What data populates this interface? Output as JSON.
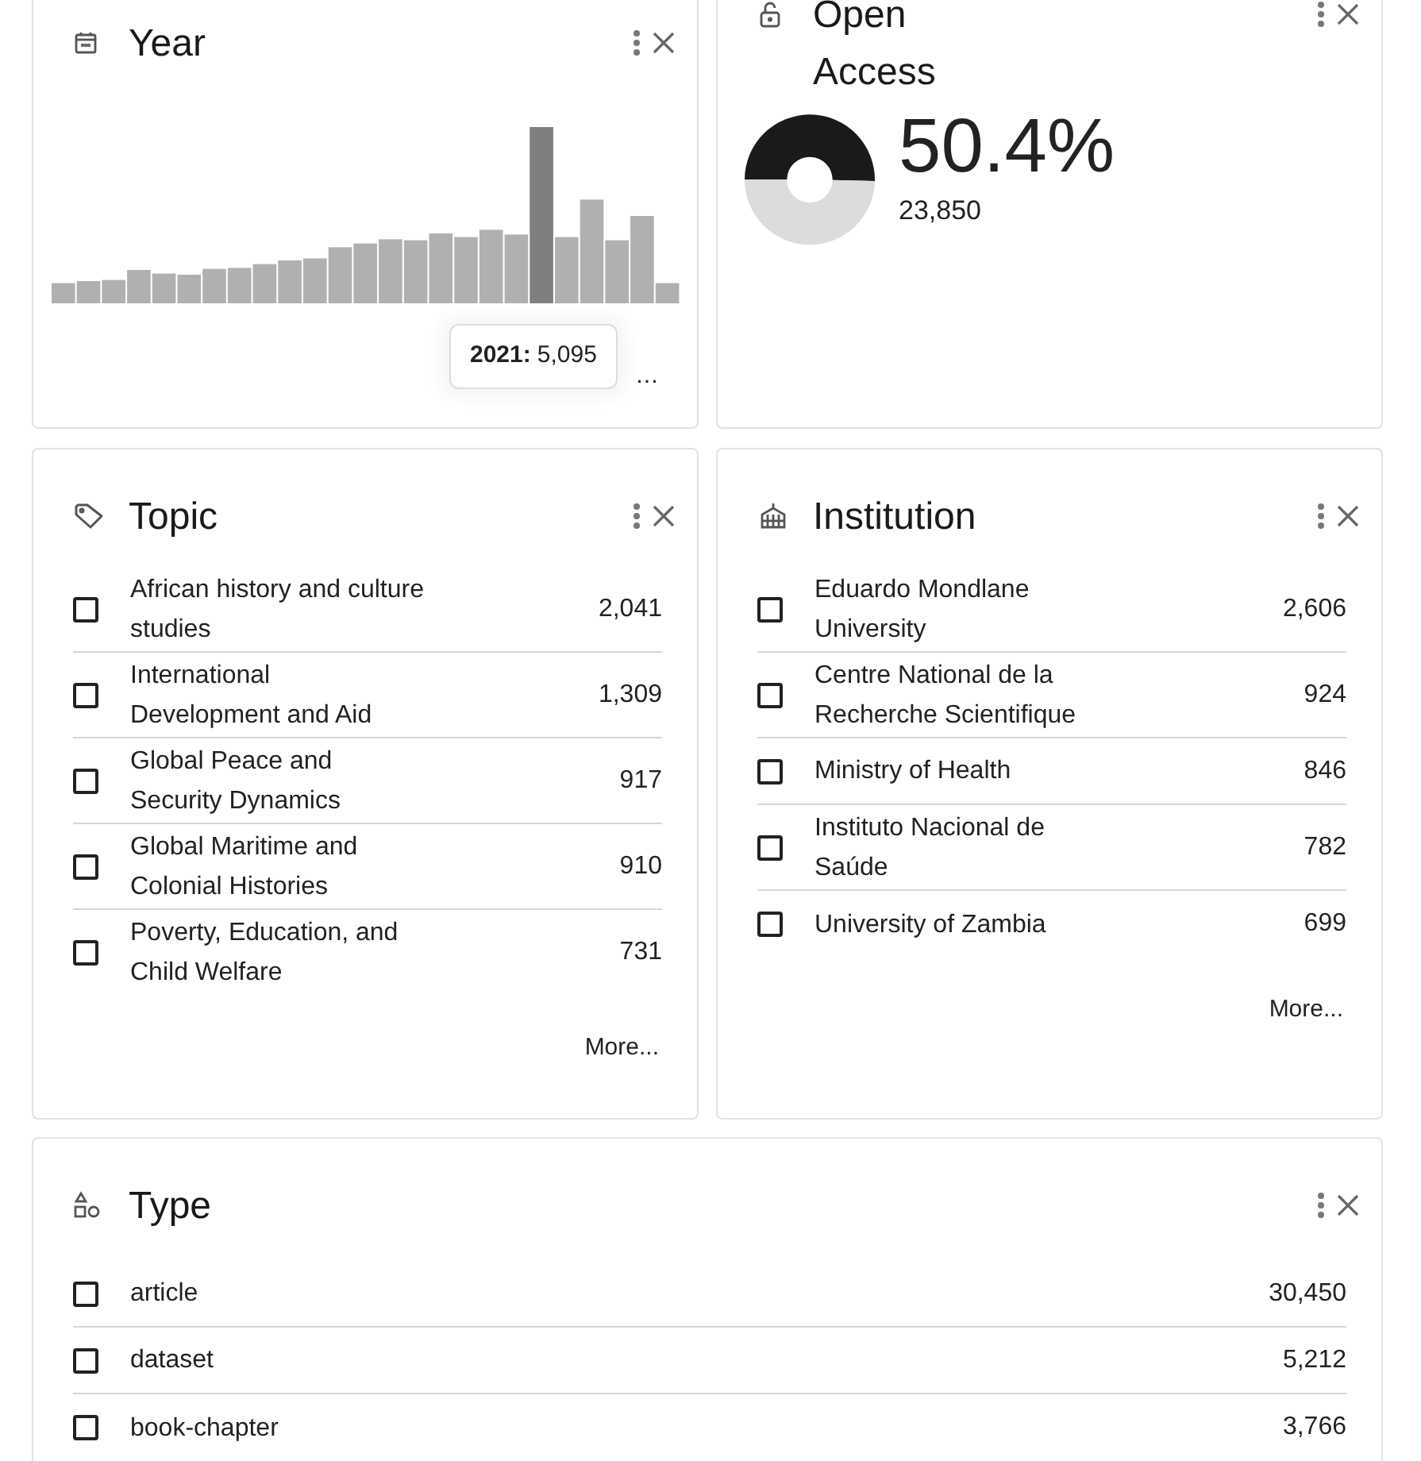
{
  "year": {
    "title": "Year",
    "tooltip": {
      "label": "2021:",
      "value": "5,095"
    },
    "overflow_label": "…"
  },
  "open_access": {
    "title": "Open Access",
    "percent": "50.4%",
    "count": "23,850",
    "chart_data": {
      "type": "donut",
      "values": [
        50.4,
        49.6
      ]
    }
  },
  "topic": {
    "title": "Topic",
    "more": "More...",
    "items": [
      {
        "label": "African history and culture studies",
        "count": "2,041",
        "checked": false
      },
      {
        "label": "International Development and Aid",
        "count": "1,309",
        "checked": false
      },
      {
        "label": "Global Peace and Security Dynamics",
        "count": "917",
        "checked": false
      },
      {
        "label": "Global Maritime and Colonial Histories",
        "count": "910",
        "checked": false
      },
      {
        "label": "Poverty, Education, and Child Welfare",
        "count": "731",
        "checked": false
      }
    ]
  },
  "institution": {
    "title": "Institution",
    "more": "More...",
    "items": [
      {
        "label": "Eduardo Mondlane University",
        "count": "2,606",
        "checked": false
      },
      {
        "label": "Centre National de la Recherche Scientifique",
        "count": "924",
        "checked": false
      },
      {
        "label": "Ministry of Health",
        "count": "846",
        "checked": false
      },
      {
        "label": "Instituto Nacional de Saúde",
        "count": "782",
        "checked": false
      },
      {
        "label": "University of Zambia",
        "count": "699",
        "checked": false
      }
    ]
  },
  "type": {
    "title": "Type",
    "items": [
      {
        "label": "article",
        "count": "30,450",
        "checked": false
      },
      {
        "label": "dataset",
        "count": "5,212",
        "checked": false
      },
      {
        "label": "book-chapter",
        "count": "3,766",
        "checked": false
      }
    ]
  }
}
